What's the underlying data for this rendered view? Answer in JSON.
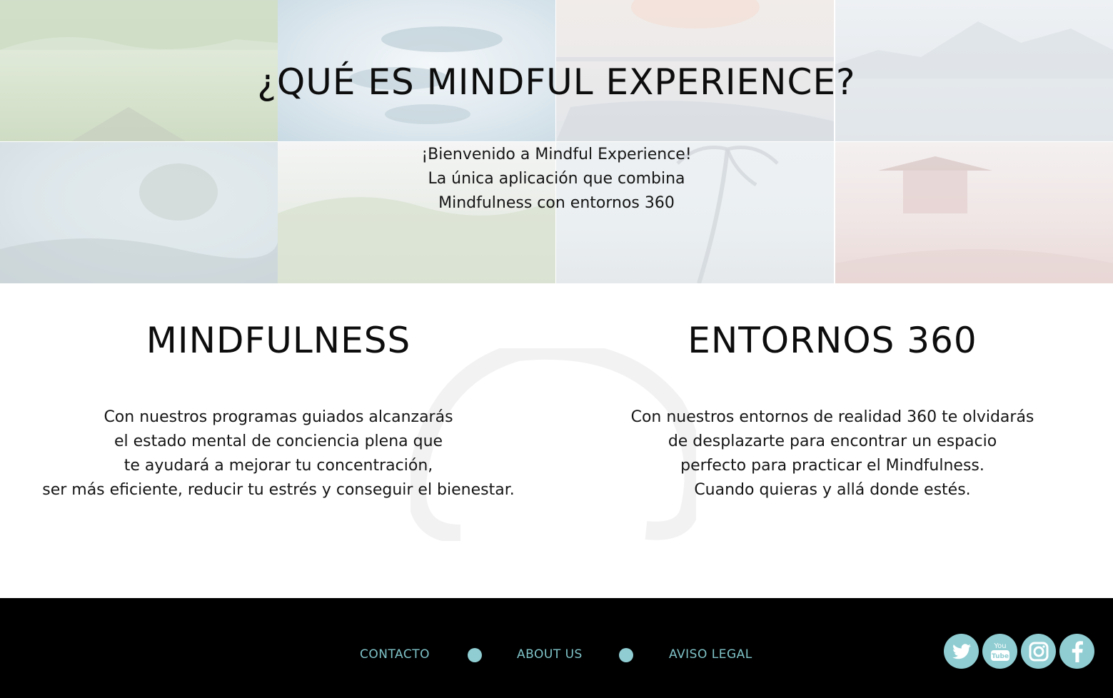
{
  "hero": {
    "title": "¿QUÉ ES MINDFUL EXPERIENCE?",
    "intro": [
      "¡Bienvenido a Mindful Experience!",
      "La única aplicación que combina",
      "Mindfulness con entornos 360"
    ]
  },
  "features": {
    "mindfulness": {
      "title": "MINDFULNESS",
      "lines": [
        "Con nuestros programas guiados alcanzarás",
        "el estado mental de conciencia plena que",
        "te ayudará a mejorar tu concentración,",
        "ser más eficiente, reducir tu estrés y conseguir el bienestar."
      ]
    },
    "entornos": {
      "title": "ENTORNOS 360",
      "lines": [
        "Con nuestros entornos de realidad 360 te olvidarás",
        "de desplazarte para encontrar un espacio",
        "perfecto para practicar el Mindfulness.",
        "Cuando quieras y allá donde estés."
      ]
    }
  },
  "footer": {
    "nav": [
      "CONTACTO",
      "ABOUT US",
      "AVISO LEGAL"
    ],
    "social": [
      {
        "name": "twitter-icon"
      },
      {
        "name": "youtube-icon",
        "label": "You Tube"
      },
      {
        "name": "instagram-icon"
      },
      {
        "name": "facebook-icon"
      }
    ],
    "accent_color": "#8fcdd2",
    "link_color": "#7fc3c8"
  }
}
